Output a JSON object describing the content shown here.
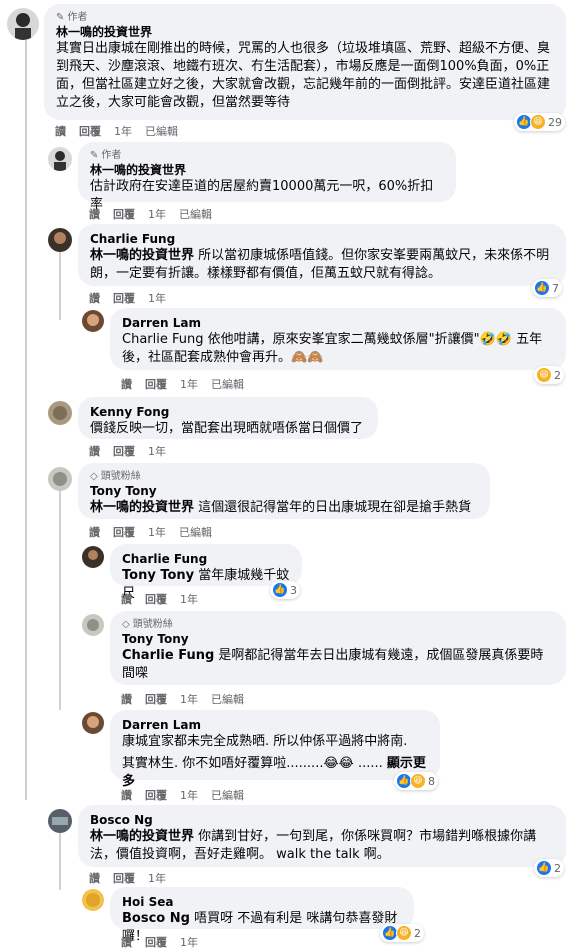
{
  "comments": [
    {
      "badge": "作者",
      "name": "林一鳴的投資世界",
      "text": "其實日出康城在剛推出的時候，咒罵的人也很多（垃圾堆填區、荒野、超級不方便、臭到飛天、沙塵滾滾、地鐵冇班次、冇生活配套），市場反應是一面倒100%負面，0%正面，但當社區建立好之後，大家就會改觀，忘記幾年前的一面倒批評。安達臣道社區建立之後，大家可能會改觀，但當然要等待",
      "reply": "讀",
      "hide": "回覆",
      "time": "1年",
      "edited": "已編輯",
      "react_count": "29"
    },
    {
      "badge": "作者",
      "name": "林一鳴的投資世界",
      "text": "估計政府在安達臣道的居屋約賣10000萬元一呎，60%折扣率",
      "reply": "讚",
      "hide": "回覆",
      "time": "1年",
      "edited": "已編輯"
    },
    {
      "name": "Charlie Fung",
      "mention": "林一鳴的投資世界",
      "text": " 所以當初康城係唔值錢。但你家安峯要兩萬蚊尺，未來係不明朗，一定要有折讓。樣樣野都有價值，佢萬五蚊尺就有得諗。",
      "reply": "讚",
      "hide": "回覆",
      "time": "1年",
      "react_count": "7"
    },
    {
      "name": "Darren Lam",
      "text": "Charlie Fung 依他咁講，原來安峯宜家二萬幾蚊係層\"折讓價\"🤣🤣 五年後，社區配套成熟仲會再升。🙈🙈",
      "reply": "讚",
      "hide": "回覆",
      "time": "1年",
      "edited": "已編輯",
      "react_count": "2"
    },
    {
      "name": "Kenny Fong",
      "text": "價錢反映一切，當配套出現晒就唔係當日個價了",
      "reply": "讚",
      "hide": "回覆",
      "time": "1年"
    },
    {
      "badge": "頭號粉絲",
      "name": "Tony Tony",
      "mention": "林一鳴的投資世界",
      "text": " 這個還很記得當年的日出康城現在卻是搶手熱貨",
      "reply": "讚",
      "hide": "回覆",
      "time": "1年",
      "edited": "已編輯"
    },
    {
      "name": "Charlie Fung",
      "mention": "Tony Tony",
      "text": " 當年康城幾千蚊尺",
      "reply": "讚",
      "hide": "回覆",
      "time": "1年",
      "react_count": "3"
    },
    {
      "badge": "頭號粉絲",
      "name": "Tony Tony",
      "mention": "Charlie Fung",
      "text": " 是啊都記得當年去日出康城有幾遠，成個區發展真係要時間㗎",
      "reply": "讚",
      "hide": "回覆",
      "time": "1年",
      "edited": "已編輯"
    },
    {
      "name": "Darren Lam",
      "text": "康城宜家都未完全成熟晒. 所以仲係平過將中將南.",
      "text2": "其實林生. 你不如唔好覆算啦.........😂😂 ......",
      "more": "顯示更多",
      "reply": "讚",
      "hide": "回覆",
      "time": "1年",
      "edited": "已編輯",
      "react_count": "8"
    },
    {
      "name": "Bosco Ng",
      "mention": "林一鳴的投資世界",
      "text": " 你講到甘好，一句到尾，你係咪買啊？市場錯判喺根據你講法，價值投資啊，吾好走雞啊。 walk the talk 啊。",
      "reply": "讚",
      "hide": "回覆",
      "time": "1年",
      "react_count": "2"
    },
    {
      "name": "Hoi Sea",
      "mention": "Bosco Ng",
      "text": " 唔買呀 不過有利是 咪講句恭喜發財囉！",
      "reply": "讚",
      "hide": "回覆",
      "time": "1年",
      "react_count": "2"
    }
  ],
  "colors": {
    "bubble": "#f0f2f5",
    "like": "#1877f2",
    "haha": "#f7b125",
    "meta": "#65676b"
  }
}
